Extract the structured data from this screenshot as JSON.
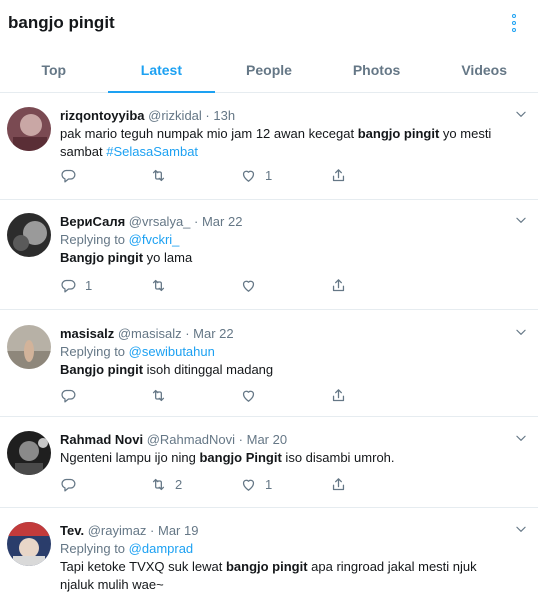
{
  "search": {
    "title": "bangjo pingit"
  },
  "tabs": [
    "Top",
    "Latest",
    "People",
    "Photos",
    "Videos"
  ],
  "tweets": [
    {
      "name": "rizqontoyyiba",
      "handle": "@rizkidal",
      "time": "13h",
      "text_before": "pak mario teguh numpak mio jam 12 awan kecegat ",
      "highlight": "bangjo pingit",
      "text_after": " yo mesti sambat ",
      "hashtag": "#SelasaSambat",
      "reply_count": "",
      "retweet_count": "",
      "like_count": "1"
    },
    {
      "name": "ВериСаля",
      "handle": "@vrsalya_",
      "time": "Mar 22",
      "replying_prefix": "Replying to ",
      "replying_to": "@fvckri_",
      "highlight": "Bangjo pingit",
      "text_after": " yo lama",
      "reply_count": "1",
      "retweet_count": "",
      "like_count": ""
    },
    {
      "name": "masisalz",
      "handle": "@masisalz",
      "time": "Mar 22",
      "replying_prefix": "Replying to ",
      "replying_to": "@sewibutahun",
      "highlight": "Bangjo pingit",
      "text_after": " isoh ditinggal madang",
      "reply_count": "",
      "retweet_count": "",
      "like_count": ""
    },
    {
      "name": "Rahmad Novi",
      "handle": "@RahmadNovi",
      "time": "Mar 20",
      "text_before": "Ngenteni lampu ijo ning ",
      "highlight": "bangjo Pingit",
      "text_after": " iso disambi umroh.",
      "reply_count": "",
      "retweet_count": "2",
      "like_count": "1"
    },
    {
      "name": "Tev.",
      "handle": "@rayimaz",
      "time": "Mar 19",
      "replying_prefix": "Replying to ",
      "replying_to": "@damprad",
      "text_before": "Tapi ketoke TVXQ suk lewat ",
      "highlight": "bangjo pingit",
      "text_after": " apa ringroad jakal mesti njuk njaluk mulih wae~"
    }
  ],
  "meta_separator": " · ",
  "icons": {
    "more": "more-vertical-icon",
    "caret": "chevron-down-icon",
    "reply": "reply-icon",
    "retweet": "retweet-icon",
    "like": "heart-icon",
    "share": "share-icon"
  },
  "colors": {
    "accent": "#1da1f2",
    "secondary_text": "#657786",
    "primary_text": "#14171a",
    "divider": "#e6ecf0"
  }
}
